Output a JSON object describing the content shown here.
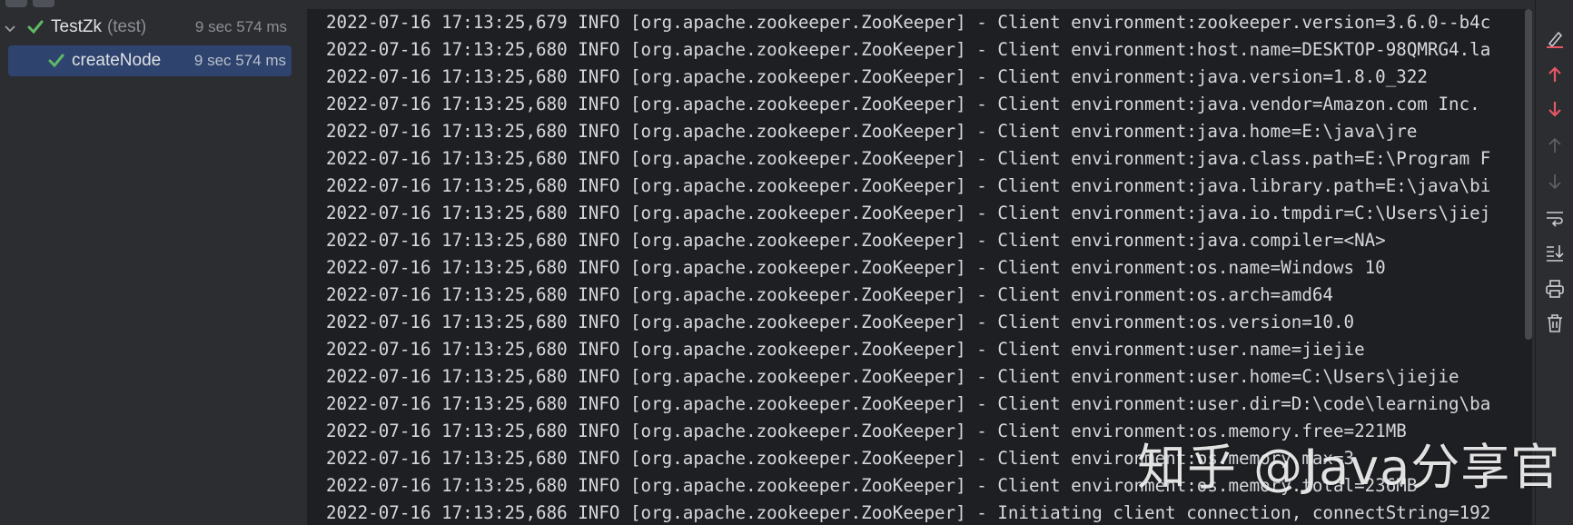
{
  "test_tree": {
    "suite": {
      "name": "TestZk",
      "qualifier": "(test)",
      "duration": "9 sec 574 ms"
    },
    "test": {
      "name": "createNode",
      "duration": "9 sec 574 ms"
    }
  },
  "console": {
    "lines": [
      "2022-07-16 17:13:25,679 INFO [org.apache.zookeeper.ZooKeeper] - Client environment:zookeeper.version=3.6.0--b4c",
      "2022-07-16 17:13:25,680 INFO [org.apache.zookeeper.ZooKeeper] - Client environment:host.name=DESKTOP-98QMRG4.la",
      "2022-07-16 17:13:25,680 INFO [org.apache.zookeeper.ZooKeeper] - Client environment:java.version=1.8.0_322",
      "2022-07-16 17:13:25,680 INFO [org.apache.zookeeper.ZooKeeper] - Client environment:java.vendor=Amazon.com Inc.",
      "2022-07-16 17:13:25,680 INFO [org.apache.zookeeper.ZooKeeper] - Client environment:java.home=E:\\java\\jre",
      "2022-07-16 17:13:25,680 INFO [org.apache.zookeeper.ZooKeeper] - Client environment:java.class.path=E:\\Program F",
      "2022-07-16 17:13:25,680 INFO [org.apache.zookeeper.ZooKeeper] - Client environment:java.library.path=E:\\java\\bi",
      "2022-07-16 17:13:25,680 INFO [org.apache.zookeeper.ZooKeeper] - Client environment:java.io.tmpdir=C:\\Users\\jiej",
      "2022-07-16 17:13:25,680 INFO [org.apache.zookeeper.ZooKeeper] - Client environment:java.compiler=<NA>",
      "2022-07-16 17:13:25,680 INFO [org.apache.zookeeper.ZooKeeper] - Client environment:os.name=Windows 10",
      "2022-07-16 17:13:25,680 INFO [org.apache.zookeeper.ZooKeeper] - Client environment:os.arch=amd64",
      "2022-07-16 17:13:25,680 INFO [org.apache.zookeeper.ZooKeeper] - Client environment:os.version=10.0",
      "2022-07-16 17:13:25,680 INFO [org.apache.zookeeper.ZooKeeper] - Client environment:user.name=jiejie",
      "2022-07-16 17:13:25,680 INFO [org.apache.zookeeper.ZooKeeper] - Client environment:user.home=C:\\Users\\jiejie",
      "2022-07-16 17:13:25,680 INFO [org.apache.zookeeper.ZooKeeper] - Client environment:user.dir=D:\\code\\learning\\ba",
      "2022-07-16 17:13:25,680 INFO [org.apache.zookeeper.ZooKeeper] - Client environment:os.memory.free=221MB",
      "2022-07-16 17:13:25,680 INFO [org.apache.zookeeper.ZooKeeper] - Client environment:os.memory.max=3",
      "2022-07-16 17:13:25,680 INFO [org.apache.zookeeper.ZooKeeper] - Client environment:os.memory.total=236MB",
      "2022-07-16 17:13:25,686 INFO [org.apache.zookeeper.ZooKeeper] - Initiating client connection, connectString=192"
    ]
  },
  "watermark": {
    "text": "知乎 @Java分享官"
  },
  "toolbar_icons": [
    "soft-wrap-pen-icon",
    "up-red-arrow-icon",
    "down-red-arrow-icon",
    "up-arrow-icon",
    "down-arrow-icon",
    "wrap-lines-icon",
    "scroll-to-end-icon",
    "print-icon",
    "trash-icon"
  ],
  "colors": {
    "pass": "#5fb865",
    "selection": "#2e436e",
    "console_bg": "#1e1f22",
    "panel_bg": "#2b2d30",
    "accent_red": "#e55765"
  }
}
